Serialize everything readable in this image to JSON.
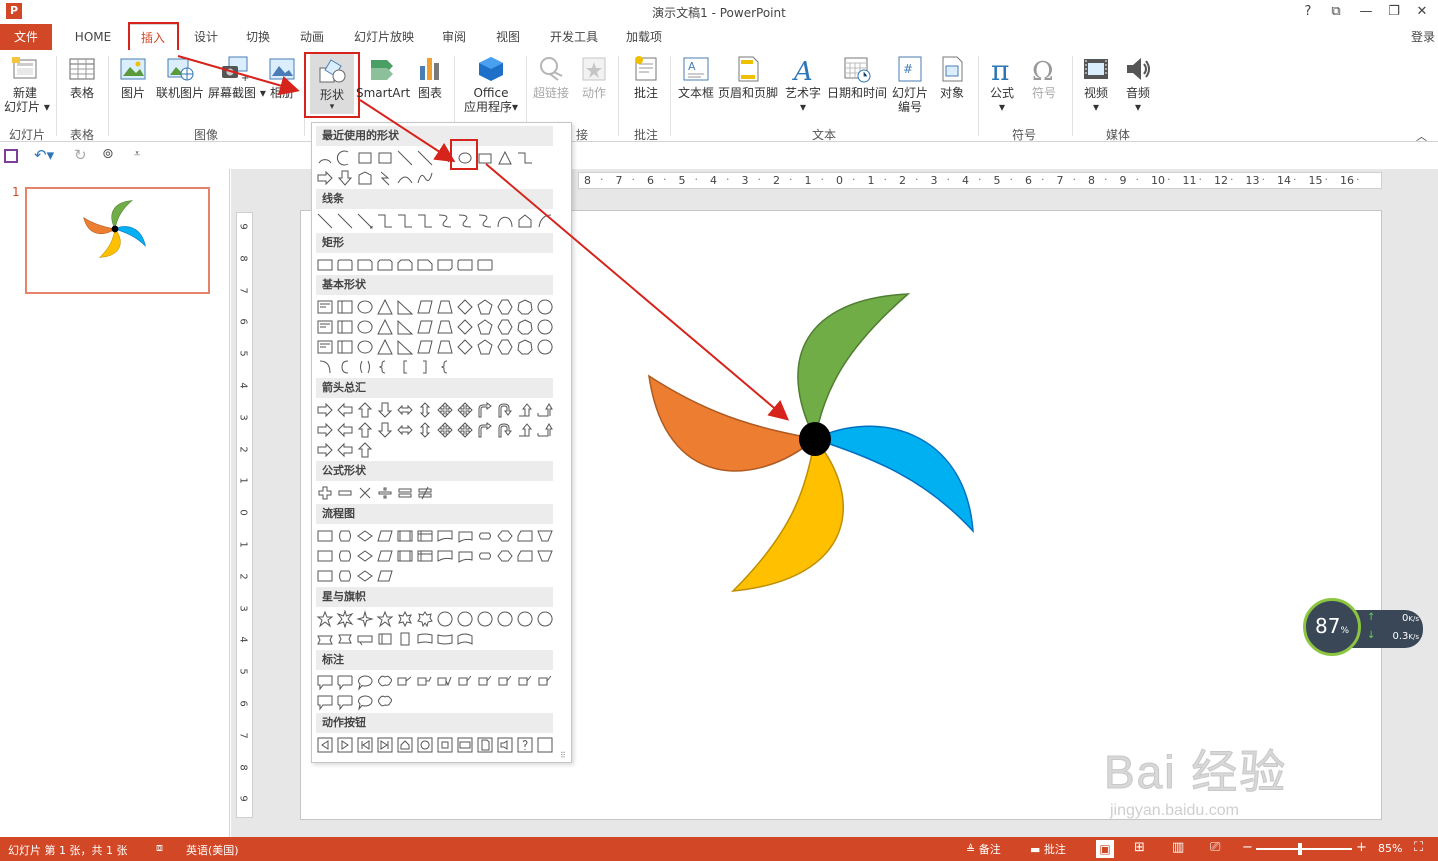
{
  "app": {
    "title": "演示文稿1 - PowerPoint",
    "logo": "P"
  },
  "window": {
    "help": "?",
    "ribbon_display": "⧉",
    "minimize": "—",
    "restore": "❐",
    "close": "✕"
  },
  "account": {
    "signin": "登录"
  },
  "tabs": [
    "文件",
    "HOME",
    "插入",
    "设计",
    "切换",
    "动画",
    "幻灯片放映",
    "审阅",
    "视图",
    "开发工具",
    "加载项"
  ],
  "ribbon": {
    "new_slide": "新建\n幻灯片",
    "table": "表格",
    "picture": "图片",
    "online_picture": "联机图片",
    "screenshot": "屏幕截图",
    "album": "相册",
    "shapes": "形状",
    "smartart": "SmartArt",
    "chart": "图表",
    "office_apps_1": "Office",
    "office_apps_2": "应用程序",
    "hyperlink": "超链接",
    "action": "动作",
    "comment": "批注",
    "textbox": "文本框",
    "header_footer": "页眉和页脚",
    "wordart": "艺术字",
    "datetime": "日期和时间",
    "slide_number_1": "幻灯片",
    "slide_number_2": "编号",
    "object": "对象",
    "equation": "公式",
    "symbol": "符号",
    "video": "视频",
    "audio": "音频",
    "groups": {
      "slides": "幻灯片",
      "tables": "表格",
      "images": "图像",
      "links": "接",
      "comments": "批注",
      "text": "文本",
      "symbols": "符号",
      "media": "媒体"
    }
  },
  "slides_panel": {
    "slide_number": "1"
  },
  "shapes_gallery": {
    "categories": [
      "最近使用的形状",
      "线条",
      "矩形",
      "基本形状",
      "箭头总汇",
      "公式形状",
      "流程图",
      "星与旗帜",
      "标注",
      "动作按钮"
    ]
  },
  "ruler": {
    "h_ticks": [
      "8",
      "7",
      "6",
      "5",
      "4",
      "3",
      "2",
      "1",
      "0",
      "1",
      "2",
      "3",
      "4",
      "5",
      "6",
      "7",
      "8",
      "9",
      "10",
      "11",
      "12",
      "13",
      "14",
      "15",
      "16"
    ],
    "v_ticks": [
      "9",
      "8",
      "7",
      "6",
      "5",
      "4",
      "3",
      "2",
      "1",
      "0",
      "1",
      "2",
      "3",
      "4",
      "5",
      "6",
      "7",
      "8",
      "9"
    ]
  },
  "status": {
    "slide_info": "幻灯片 第 1 张，共 1 张",
    "language": "英语(美国)",
    "notes": "备注",
    "comments": "批注",
    "zoom": "85%"
  },
  "net_widget": {
    "percent": "87",
    "percent_unit": "%",
    "up": "0",
    "down": "0.3",
    "unit": "K/s"
  },
  "watermark": {
    "brand": "Bai 经验",
    "url": "jingyan.baidu.com"
  },
  "colors": {
    "accent": "#d24726",
    "highlight": "#d6231c",
    "green": "#70ad47",
    "blue": "#00b0f0",
    "orange": "#ed7d31",
    "yellow": "#ffc000"
  }
}
